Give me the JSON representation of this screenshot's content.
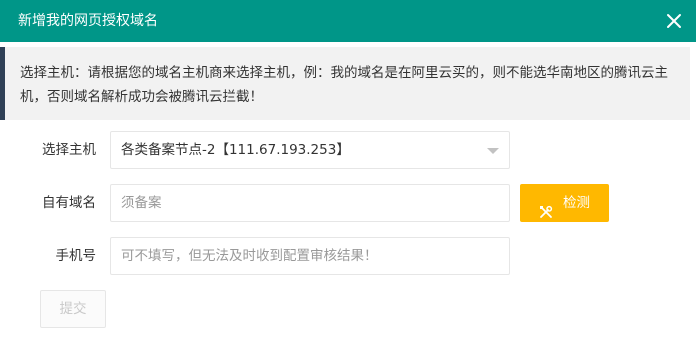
{
  "dialog": {
    "title": "新增我的网页授权域名",
    "close_icon": "close-icon"
  },
  "notice": {
    "text": "选择主机：请根据您的域名主机商来选择主机，例：我的域名是在阿里云买的，则不能选华南地区的腾讯云主机，否则域名解析成功会被腾讯云拦截！"
  },
  "form": {
    "host": {
      "label": "选择主机",
      "value": "各类备案节点-2【111.67.193.253】"
    },
    "domain": {
      "label": "自有域名",
      "placeholder": "须备案",
      "check_label": "检测",
      "check_icon": "tools-icon"
    },
    "phone": {
      "label": "手机号",
      "placeholder": "可不填写，但无法及时收到配置审核结果！"
    },
    "submit_label": "提交"
  },
  "colors": {
    "header": "#009688",
    "notice_bg": "#f2f2f2",
    "notice_border": "#2f4056",
    "check_button": "#ffb800"
  }
}
